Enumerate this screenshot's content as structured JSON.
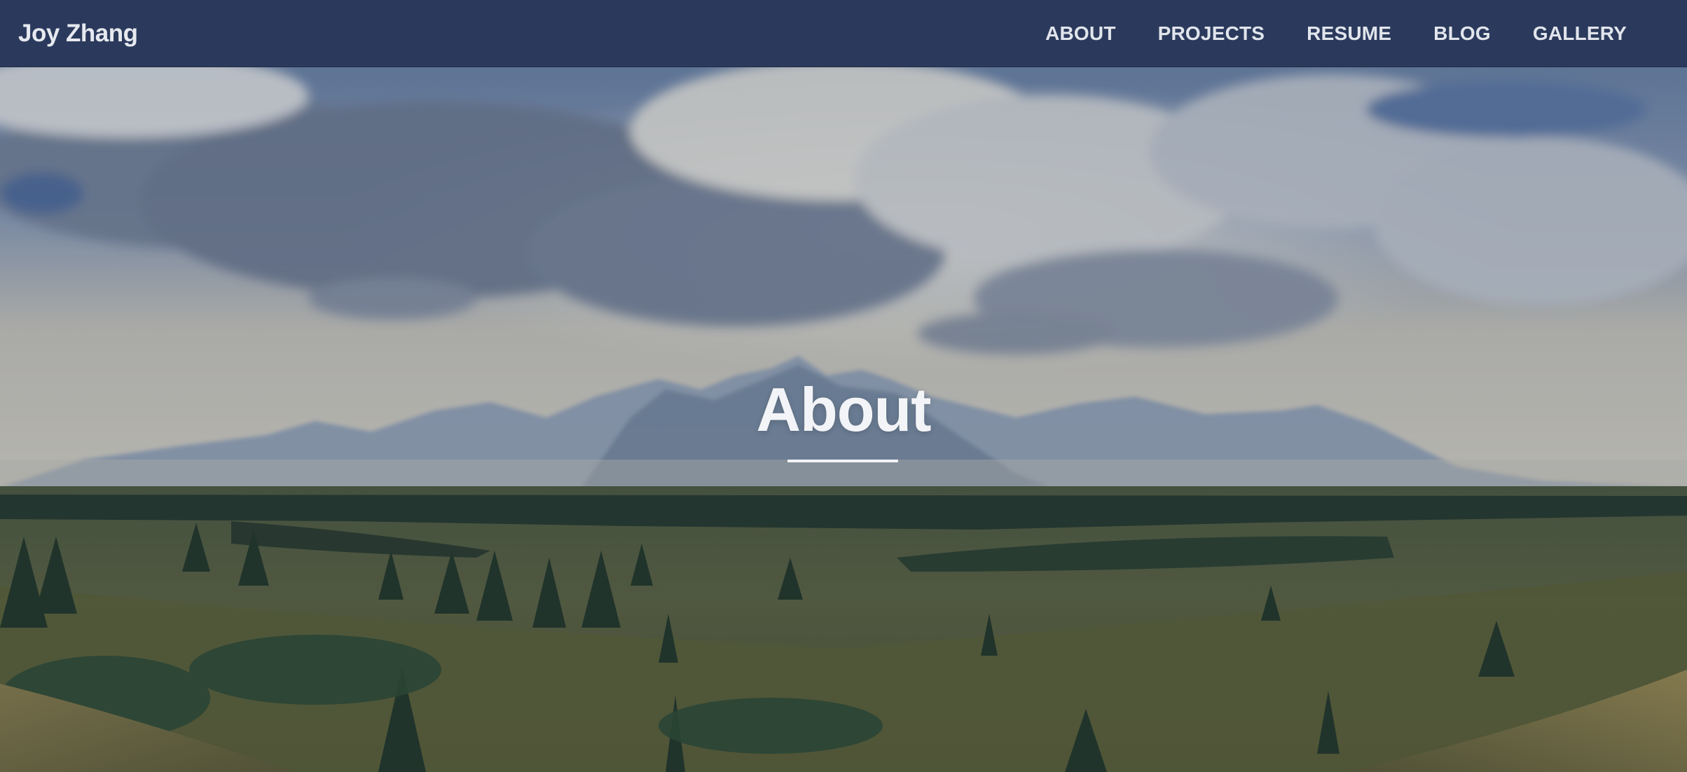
{
  "site": {
    "brand": "Joy Zhang"
  },
  "nav": {
    "items": [
      {
        "label": "ABOUT"
      },
      {
        "label": "PROJECTS"
      },
      {
        "label": "RESUME"
      },
      {
        "label": "BLOG"
      },
      {
        "label": "GALLERY"
      }
    ]
  },
  "hero": {
    "title": "About",
    "background_image": "mountain-landscape-photo"
  },
  "colors": {
    "navbar_bg": "#2b3a5c",
    "nav_text": "#e1e5ec",
    "hero_text": "#f3f4f7"
  }
}
